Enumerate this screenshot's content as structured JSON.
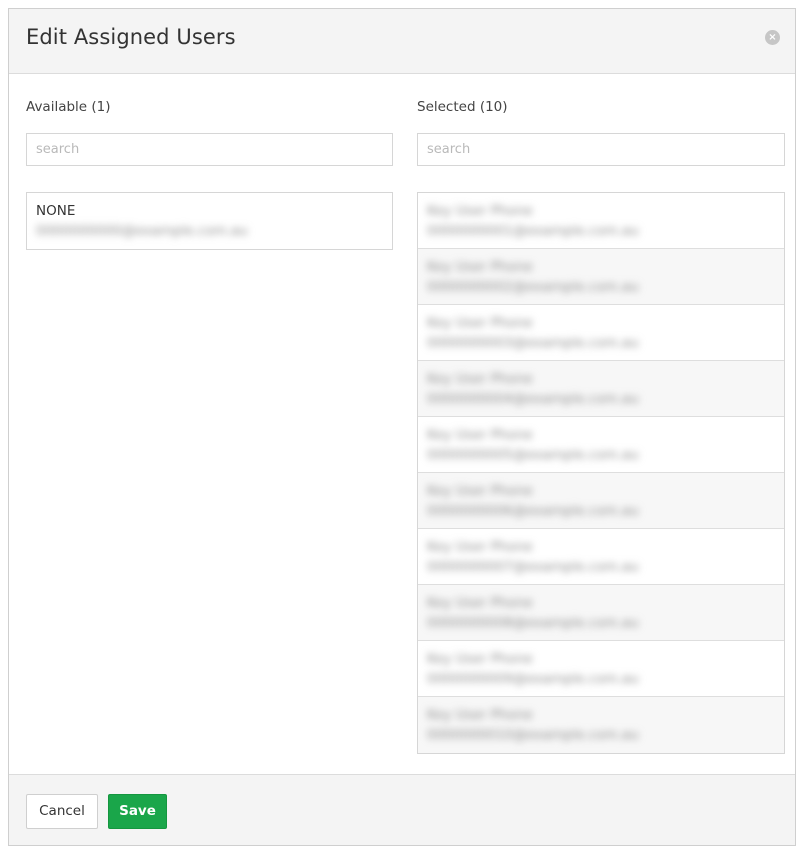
{
  "dialog": {
    "title": "Edit Assigned Users",
    "close_glyph": "×"
  },
  "available": {
    "label": "Available (1)",
    "search_placeholder": "search",
    "items": [
      {
        "name": "NONE",
        "email": "0000000000@example.com.au"
      }
    ]
  },
  "selected": {
    "label": "Selected (10)",
    "search_placeholder": "search",
    "items": [
      {
        "name": "Key User Phone",
        "email": "0000000001@example.com.au"
      },
      {
        "name": "Key User Phone",
        "email": "0000000002@example.com.au"
      },
      {
        "name": "Key User Phone",
        "email": "0000000003@example.com.au"
      },
      {
        "name": "Key User Phone",
        "email": "0000000004@example.com.au"
      },
      {
        "name": "Key User Phone",
        "email": "0000000005@example.com.au"
      },
      {
        "name": "Key User Phone",
        "email": "0000000006@example.com.au"
      },
      {
        "name": "Key User Phone",
        "email": "0000000007@example.com.au"
      },
      {
        "name": "Key User Phone",
        "email": "0000000008@example.com.au"
      },
      {
        "name": "Key User Phone",
        "email": "0000000009@example.com.au"
      },
      {
        "name": "Key User Phone",
        "email": "0000000010@example.com.au"
      }
    ]
  },
  "footer": {
    "cancel_label": "Cancel",
    "save_label": "Save"
  },
  "colors": {
    "save_button": "#1aa64a",
    "header_background": "#f4f4f4"
  }
}
